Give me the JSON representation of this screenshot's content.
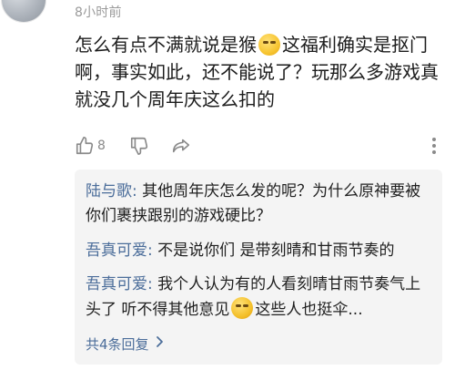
{
  "comment": {
    "time": "8小时前",
    "text_part1": "怎么有点不满就说是猴",
    "emoji1": "smug-face-emoji",
    "text_part2": "这福利确实是抠门啊，事实如此，还不能说了？玩那么多游戏真就没几个周年庆这么扣的",
    "like_count": "8"
  },
  "replies": [
    {
      "name": "陆与歌",
      "colon": ":",
      "text": " 其他周年庆怎么发的呢？为什么原神要被你们裹挟跟别的游戏硬比？"
    },
    {
      "name": "吾真可爱",
      "colon": ":",
      "text": " 不是说你们 是带刻晴和甘雨节奏的"
    },
    {
      "name": "吾真可爱",
      "colon": ":",
      "text_part1": " 我个人认为有的人看刻晴甘雨节奏气上头了 听不得其他意见",
      "emoji": "facepalm-emoji",
      "text_part2": "这些人也挺伞..."
    }
  ],
  "expand_label": "共4条回复",
  "icons": {
    "like": "thumbs-up-icon",
    "dislike": "thumbs-down-icon",
    "share": "share-icon",
    "more": "more-vertical-icon",
    "expand": "chevron-right-icon"
  },
  "colors": {
    "link": "#4b6d9a",
    "muted": "#8a8a8a",
    "reply_bg": "#f4f4f4"
  }
}
